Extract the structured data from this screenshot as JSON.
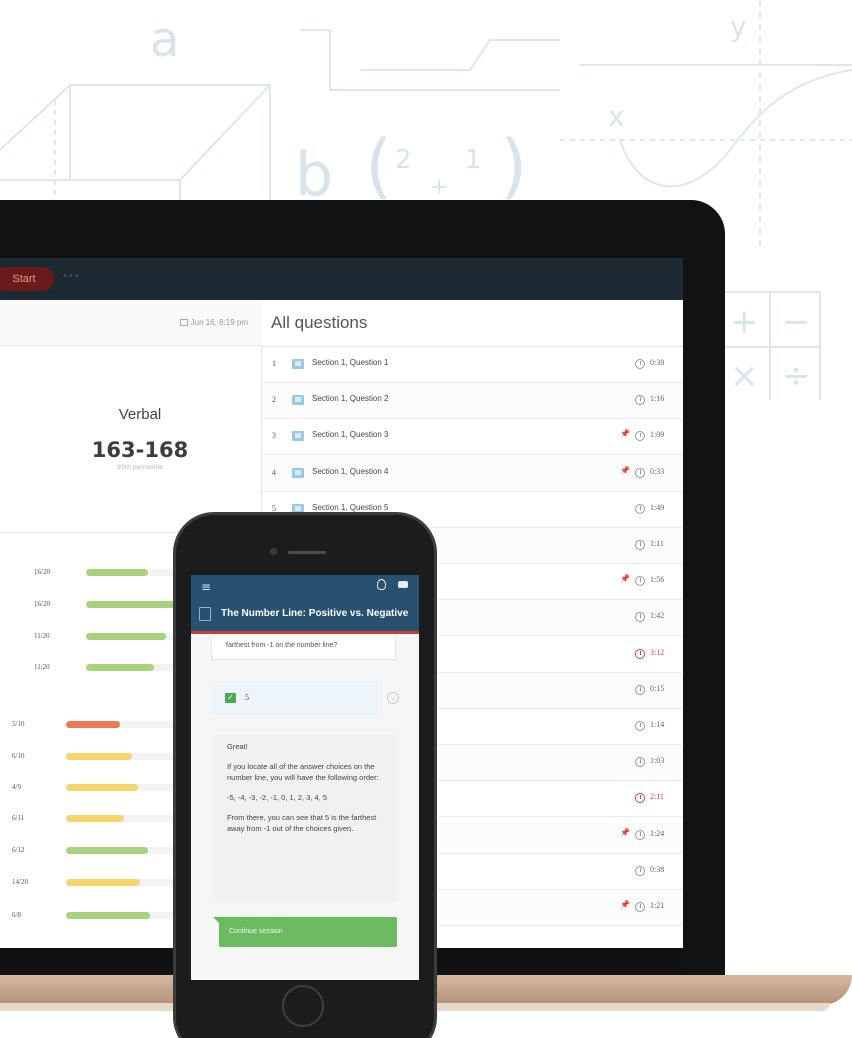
{
  "background": {
    "glyph_a": "a",
    "glyph_b": "b",
    "glyph_x": "x",
    "glyph_y": "y",
    "glyph_frac1": "2",
    "glyph_frac2": "1",
    "glyph_plus": "+",
    "glyph_minus": "−",
    "glyph_times": "×",
    "glyph_div": "÷",
    "glyph_lparen": "(",
    "glyph_rparen": ")"
  },
  "laptop": {
    "topbar": {
      "start_label": "Start",
      "dots": "•••"
    },
    "left": {
      "date": "Jun 16, 8:19 pm",
      "score_label": "Verbal",
      "score_value": "163-168",
      "score_sub": "95th percentile",
      "bars": [
        {
          "label": "16/20",
          "fill": 0.62,
          "color": "#a8d37c"
        },
        {
          "label": "16/20",
          "fill": 0.95,
          "color": "#a8d37c"
        },
        {
          "label": "11/20",
          "fill": 0.8,
          "color": "#a8d37c"
        },
        {
          "label": "11/20",
          "fill": 0.68,
          "color": "#a8d37c"
        },
        {
          "label": "5/10",
          "fill": 0.45,
          "color": "#ed7a52"
        },
        {
          "label": "6/10",
          "fill": 0.55,
          "color": "#f5d66b"
        },
        {
          "label": "4/9",
          "fill": 0.6,
          "color": "#f5d66b"
        },
        {
          "label": "6/11",
          "fill": 0.48,
          "color": "#f5d66b"
        },
        {
          "label": "6/12",
          "fill": 0.68,
          "color": "#a8d37c"
        },
        {
          "label": "14/20",
          "fill": 0.62,
          "color": "#f5d66b"
        },
        {
          "label": "6/8",
          "fill": 0.7,
          "color": "#a8d37c"
        }
      ]
    },
    "right": {
      "title": "All questions",
      "questions": [
        {
          "num": "1",
          "title": "Section 1, Question 1",
          "pin": false,
          "time": "0:38",
          "red": false
        },
        {
          "num": "2",
          "title": "Section 1, Question 2",
          "pin": false,
          "time": "1:16",
          "red": false
        },
        {
          "num": "3",
          "title": "Section 1, Question 3",
          "pin": true,
          "time": "1:09",
          "red": false
        },
        {
          "num": "4",
          "title": "Section 1, Question 4",
          "pin": true,
          "time": "0:33",
          "red": false
        },
        {
          "num": "5",
          "title": "Section 1, Question 5",
          "pin": false,
          "time": "1:49",
          "red": false
        },
        {
          "num": "",
          "title": "",
          "pin": false,
          "time": "1:11",
          "red": false
        },
        {
          "num": "",
          "title": "",
          "pin": true,
          "time": "1:56",
          "red": false
        },
        {
          "num": "",
          "title": "",
          "pin": false,
          "time": "1:42",
          "red": false
        },
        {
          "num": "",
          "title": "",
          "pin": false,
          "time": "3:12",
          "red": true
        },
        {
          "num": "",
          "title": "",
          "pin": false,
          "time": "0:15",
          "red": false
        },
        {
          "num": "",
          "title": "",
          "pin": false,
          "time": "1:14",
          "red": false
        },
        {
          "num": "",
          "title": "",
          "pin": false,
          "time": "1:03",
          "red": false
        },
        {
          "num": "",
          "title": "",
          "pin": false,
          "time": "2:11",
          "red": true
        },
        {
          "num": "",
          "title": "",
          "pin": true,
          "time": "1:24",
          "red": false
        },
        {
          "num": "",
          "title": "",
          "pin": false,
          "time": "0:38",
          "red": false
        },
        {
          "num": "",
          "title": "",
          "pin": true,
          "time": "1:21",
          "red": false
        }
      ]
    }
  },
  "phone": {
    "lesson_title": "The Number Line: Positive vs. Negative",
    "question_tail": "farthest from -1 on the number line?",
    "answer": "5",
    "explanation": [
      "Great!",
      "If you locate all of the answer choices on the number line, you will have the following order:",
      "-5, -4, -3, -2, -1, 0, 1, 2, 3, 4, 5",
      "From there, you can see that 5 is the farthest away from -1 out of the choices given."
    ],
    "continue_label": "Continue session"
  }
}
